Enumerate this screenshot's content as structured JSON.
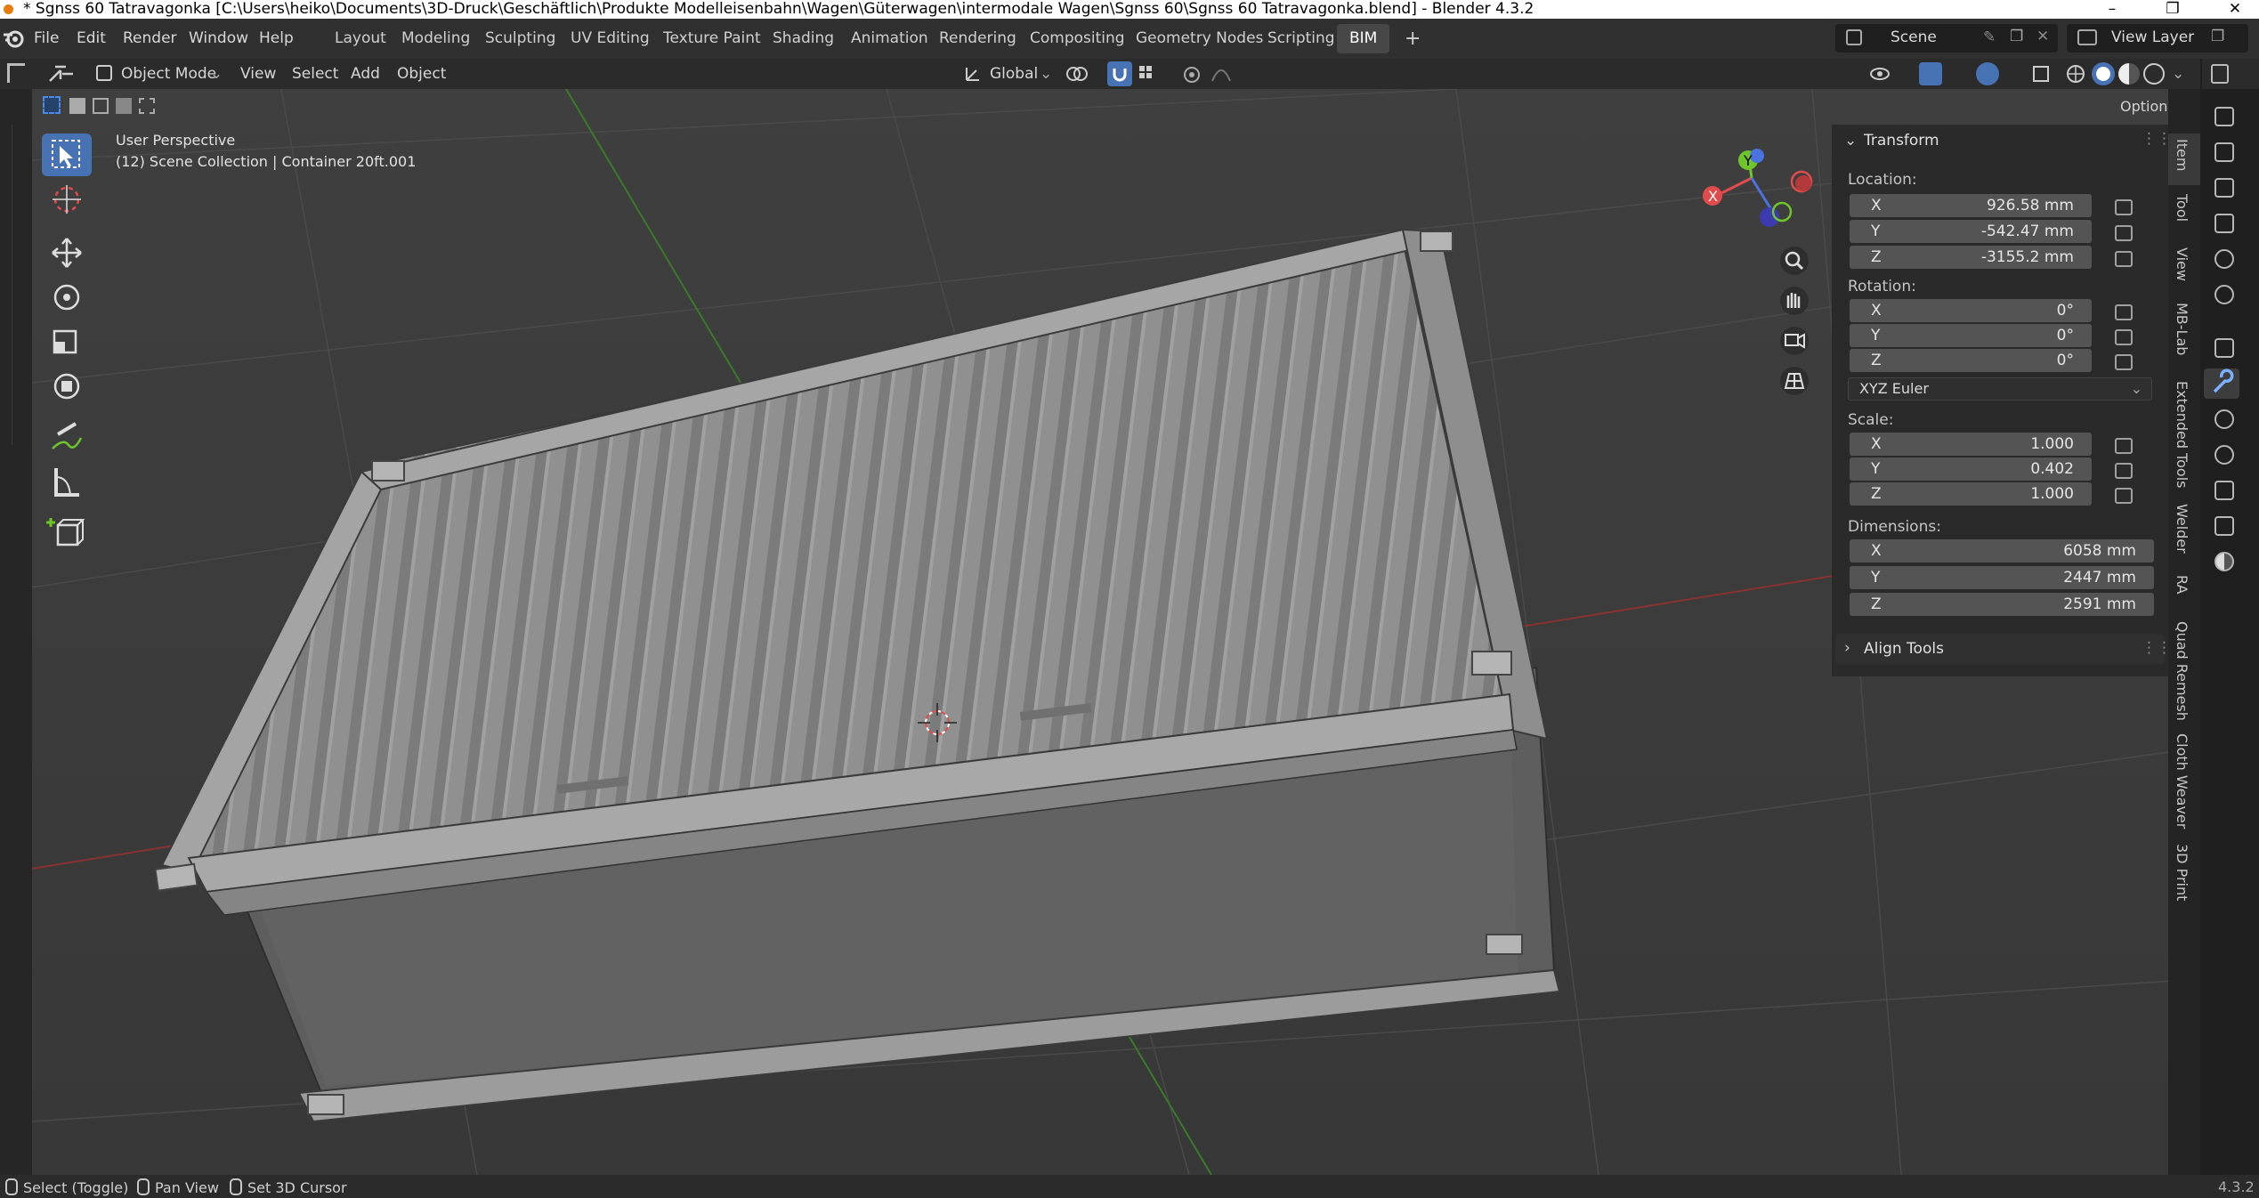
{
  "window": {
    "title": "* Sgnss 60 Tatravagonka [C:\\Users\\heiko\\Documents\\3D-Druck\\Geschäftlich\\Produkte Modelleisenbahn\\Wagen\\Güterwagen\\intermodale Wagen\\Sgnss 60\\Sgnss 60 Tatravagonka.blend] - Blender 4.3.2",
    "controls": [
      "–",
      "❐",
      "✕"
    ]
  },
  "menu": [
    "File",
    "Edit",
    "Render",
    "Window",
    "Help"
  ],
  "workspaces": [
    {
      "label": "Layout",
      "active": false
    },
    {
      "label": "Modeling",
      "active": false
    },
    {
      "label": "Sculpting",
      "active": false
    },
    {
      "label": "UV Editing",
      "active": false
    },
    {
      "label": "Texture Paint",
      "active": false
    },
    {
      "label": "Shading",
      "active": false
    },
    {
      "label": "Animation",
      "active": false
    },
    {
      "label": "Rendering",
      "active": false
    },
    {
      "label": "Compositing",
      "active": false
    },
    {
      "label": "Geometry Nodes",
      "active": false
    },
    {
      "label": "Scripting",
      "active": false
    },
    {
      "label": "BIM",
      "active": true
    }
  ],
  "add_workspace": "+",
  "scene": {
    "label": "Scene"
  },
  "view_layer": {
    "label": "View Layer"
  },
  "viewport_header": {
    "mode": "Object Mode",
    "menus": [
      "View",
      "Select",
      "Add",
      "Object"
    ],
    "orientation": "Global",
    "options": "Options"
  },
  "viewport": {
    "perspective": "User Perspective",
    "collection": "(12) Scene Collection | Container 20ft.001"
  },
  "gizmo": {
    "x": "X",
    "y": "Y"
  },
  "npanel": {
    "transform_title": "Transform",
    "location_label": "Location:",
    "location": [
      {
        "axis": "X",
        "value": "926.58 mm"
      },
      {
        "axis": "Y",
        "value": "-542.47 mm"
      },
      {
        "axis": "Z",
        "value": "-3155.2 mm"
      }
    ],
    "rotation_label": "Rotation:",
    "rotation": [
      {
        "axis": "X",
        "value": "0°"
      },
      {
        "axis": "Y",
        "value": "0°"
      },
      {
        "axis": "Z",
        "value": "0°"
      }
    ],
    "rotation_mode": "XYZ Euler",
    "scale_label": "Scale:",
    "scale": [
      {
        "axis": "X",
        "value": "1.000"
      },
      {
        "axis": "Y",
        "value": "0.402"
      },
      {
        "axis": "Z",
        "value": "1.000"
      }
    ],
    "dimensions_label": "Dimensions:",
    "dimensions": [
      {
        "axis": "X",
        "value": "6058 mm"
      },
      {
        "axis": "Y",
        "value": "2447 mm"
      },
      {
        "axis": "Z",
        "value": "2591 mm"
      }
    ],
    "align_tools": "Align Tools"
  },
  "side_tabs": [
    "Item",
    "Tool",
    "View",
    "MB-Lab",
    "Extended Tools",
    "Welder",
    "RA",
    "Quad Remesh",
    "Cloth Weaver",
    "3D Print"
  ],
  "status": {
    "select": "Select (Toggle)",
    "pan": "Pan View",
    "cursor": "Set 3D Cursor",
    "version": "4.3.2"
  },
  "colors": {
    "accent": "#4772b3",
    "axis_x": "#e04b4b",
    "axis_y": "#6ec62a",
    "axis_z": "#4b73e0"
  }
}
